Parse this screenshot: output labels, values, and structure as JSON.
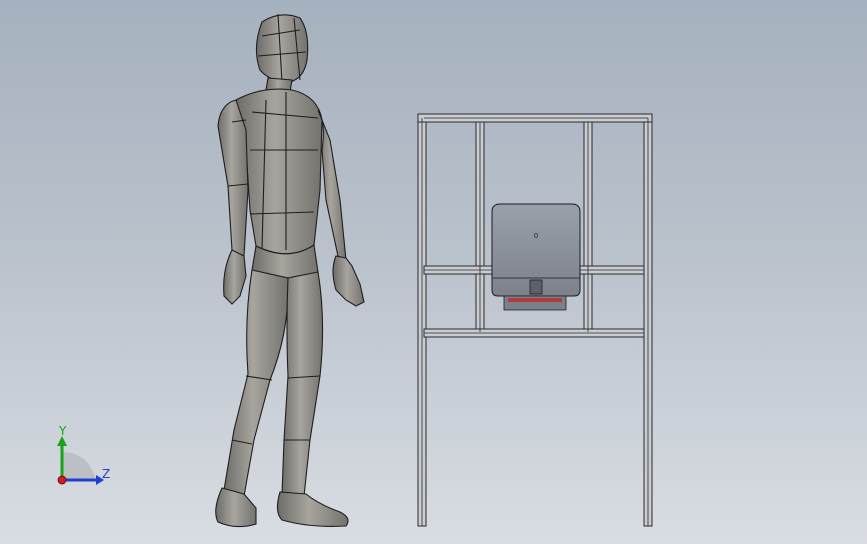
{
  "viewport": {
    "background_top": "#a6b1bf",
    "background_bottom": "#d9dde3"
  },
  "model": {
    "mannequin_color": "#8e8b85",
    "frame_color": "#c9ccd1",
    "panel_color": "#8a8f99",
    "accent_color": "#b23a3a",
    "panel_mark": "0"
  },
  "triad": {
    "y_label": "Y",
    "z_label": "Z",
    "y_color": "#1aa31a",
    "z_color": "#1f3fcf",
    "x_color": "#d01c1c"
  }
}
